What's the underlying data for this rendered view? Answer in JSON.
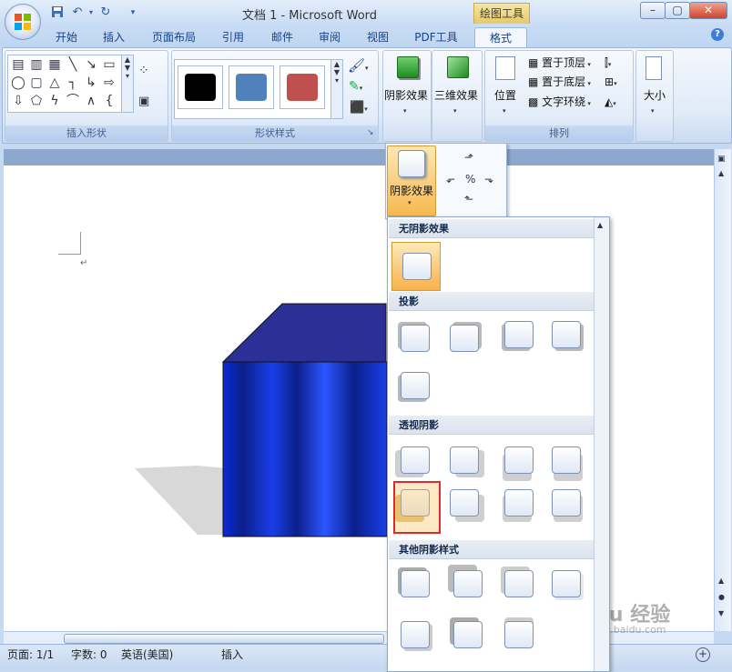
{
  "window": {
    "title": "文档 1 - Microsoft Word",
    "context_tab_title": "绘图工具",
    "controls": {
      "minimize": "–",
      "maximize": "▢",
      "close": "✕"
    }
  },
  "quick_access": {
    "save_icon": "save-icon",
    "undo_icon": "undo-icon",
    "redo_icon": "redo-icon",
    "customize_icon": "customize-icon"
  },
  "tabs": [
    {
      "label": "开始"
    },
    {
      "label": "插入"
    },
    {
      "label": "页面布局"
    },
    {
      "label": "引用"
    },
    {
      "label": "邮件"
    },
    {
      "label": "审阅"
    },
    {
      "label": "视图"
    },
    {
      "label": "PDF工具"
    },
    {
      "label": "格式",
      "selected": true
    }
  ],
  "ribbon": {
    "insert_shapes": {
      "label": "插入形状"
    },
    "shape_styles": {
      "label": "形状样式",
      "swatches": [
        "#000000",
        "#4f81bd",
        "#c0504d"
      ]
    },
    "shadow_effects": {
      "label": "阴影效果"
    },
    "effects_3d": {
      "label": "三维效果"
    },
    "arrange": {
      "label": "排列",
      "position": "位置",
      "bring_to_front": "置于顶层",
      "send_to_back": "置于底层",
      "text_wrapping": "文字环绕"
    },
    "size": {
      "label": "大小"
    }
  },
  "popup": {
    "shadow_button_label": "阴影效果"
  },
  "gallery": {
    "sections": [
      {
        "title": "无阴影效果",
        "count": 1
      },
      {
        "title": "投影",
        "count": 5
      },
      {
        "title": "透视阴影",
        "count": 8
      },
      {
        "title": "其他阴影样式",
        "count": 7
      }
    ],
    "selected_item": "透视阴影-5"
  },
  "status": {
    "page": "页面: 1/1",
    "words": "字数: 0",
    "language": "英语(美国)",
    "mode": "插入"
  },
  "watermark": {
    "text": "Baidu 经验",
    "sub": "jingyan.baidu.com"
  }
}
